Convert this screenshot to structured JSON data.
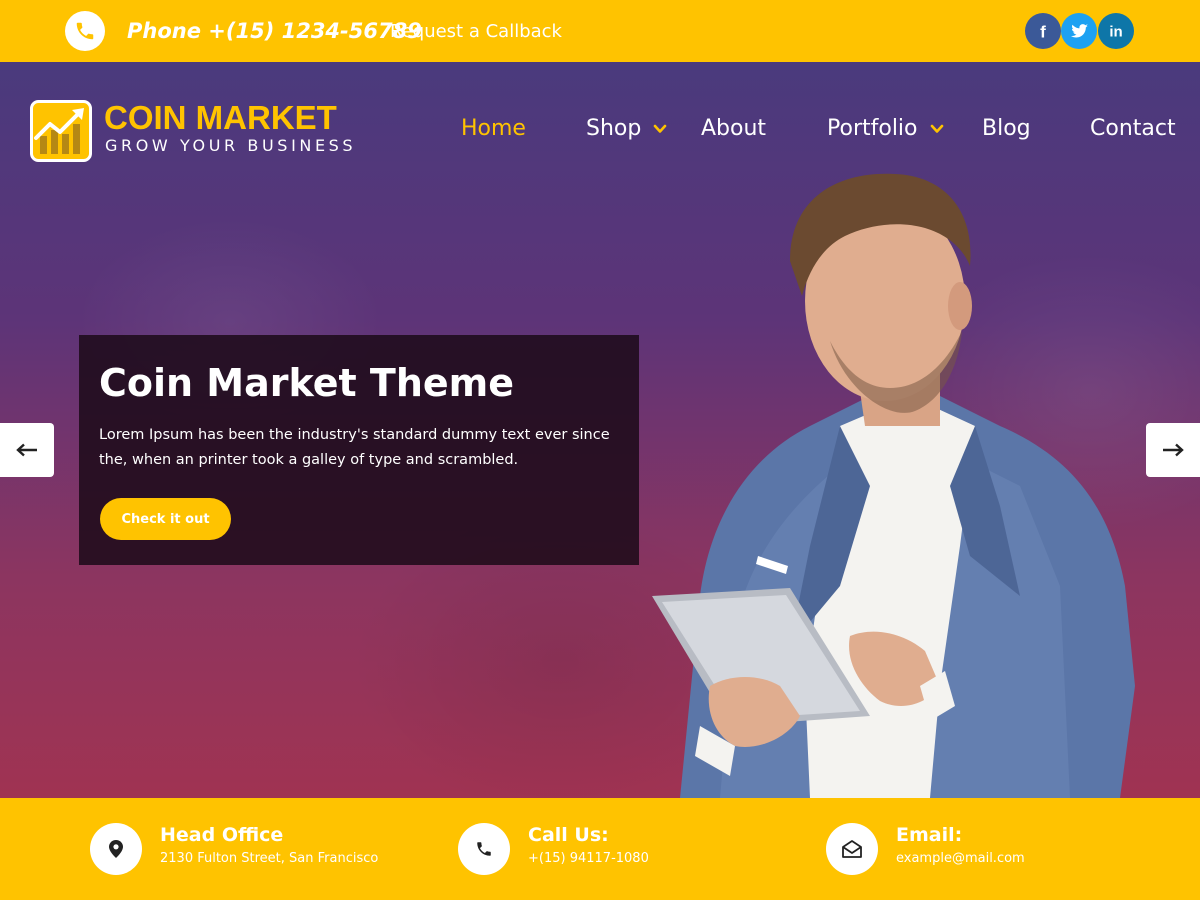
{
  "topbar": {
    "phone": "Phone +(15) 1234-56789",
    "callback": "Request a Callback",
    "social": [
      {
        "name": "facebook",
        "glyph": "f",
        "color": "#3b5998"
      },
      {
        "name": "twitter",
        "glyph": "twitter-bird",
        "color": "#1da1f2"
      },
      {
        "name": "linkedin",
        "glyph": "in",
        "color": "#0e76a8"
      }
    ]
  },
  "brand": {
    "title": "COIN MARKET",
    "tagline": "GROW YOUR BUSINESS",
    "accent": "#ffc300"
  },
  "nav": {
    "items": [
      {
        "label": "Home",
        "active": true,
        "dropdown": false
      },
      {
        "label": "Shop",
        "active": false,
        "dropdown": true
      },
      {
        "label": "About",
        "active": false,
        "dropdown": false
      },
      {
        "label": "Portfolio",
        "active": false,
        "dropdown": true
      },
      {
        "label": "Blog",
        "active": false,
        "dropdown": false
      },
      {
        "label": "Contact",
        "active": false,
        "dropdown": false
      }
    ]
  },
  "hero": {
    "title": "Coin Market Theme",
    "text": "Lorem Ipsum has been the industry's standard dummy text ever since the, when an printer took a galley of type and scrambled.",
    "button": "Check it out",
    "prev_icon": "arrow-left-icon",
    "next_icon": "arrow-right-icon"
  },
  "info": [
    {
      "title": "Head Office",
      "value": "2130 Fulton Street, San Francisco",
      "icon": "map-pin-icon"
    },
    {
      "title": "Call Us:",
      "value": "+(15) 94117-1080",
      "icon": "phone-icon"
    },
    {
      "title": "Email:",
      "value": "example@mail.com",
      "icon": "envelope-icon"
    }
  ],
  "colors": {
    "accent": "#ffc300",
    "white": "#ffffff",
    "caption_bg": "#1c0a18"
  }
}
